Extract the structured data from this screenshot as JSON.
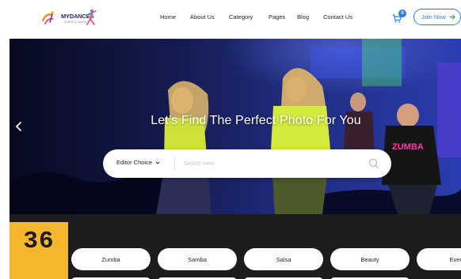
{
  "header": {
    "logo": {
      "brand": "MYDANCES",
      "tagline": "SHAPE & DANCE"
    },
    "nav": [
      {
        "label": "Home"
      },
      {
        "label": "About Us"
      },
      {
        "label": "Category"
      },
      {
        "label": "Pages"
      },
      {
        "label": "Blog"
      },
      {
        "label": "Contact Us"
      }
    ],
    "cart": {
      "count": "0",
      "icon": "cart-icon"
    },
    "join_button": {
      "label": "Join Now",
      "icon": "arrow-right-icon"
    }
  },
  "hero": {
    "title": "Let’s Find The Perfect Photo For You",
    "prev_icon": "chevron-left-icon",
    "search": {
      "select_value": "Editor Choice",
      "placeholder": "Search here",
      "button_icon": "search-icon"
    }
  },
  "category_strip": {
    "counter": "36",
    "categories": [
      {
        "label": "Zumba"
      },
      {
        "label": "Samba"
      },
      {
        "label": "Salsa"
      },
      {
        "label": "Beauty"
      },
      {
        "label": "Even"
      }
    ]
  },
  "colors": {
    "accent": "#2f7de1",
    "counter_bg": "#f4b62c",
    "strip_bg": "#1c1c1e"
  }
}
